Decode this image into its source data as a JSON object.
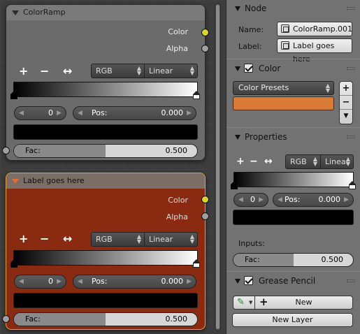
{
  "node1": {
    "title": "ColorRamp",
    "out_color": "Color",
    "out_alpha": "Alpha",
    "mode": "RGB",
    "interp": "Linear",
    "stop_index": "0",
    "pos_label": "Pos:",
    "pos_value": "0.000",
    "fac_label": "Fac:",
    "fac_value": "0.500",
    "fac_fraction": 0.5
  },
  "node2": {
    "title": "Label goes here",
    "out_color": "Color",
    "out_alpha": "Alpha",
    "mode": "RGB",
    "interp": "Linear",
    "stop_index": "0",
    "pos_label": "Pos:",
    "pos_value": "0.000",
    "fac_label": "Fac:",
    "fac_value": "0.500",
    "fac_fraction": 0.5,
    "color": "#8a2a10"
  },
  "controls": {
    "add": "+",
    "remove": "−",
    "flip": "↔"
  },
  "panel": {
    "node_section": {
      "title": "Node",
      "name_label": "Name:",
      "name_value": "ColorRamp.001",
      "label_label": "Label:",
      "label_value": "Label goes here"
    },
    "color_section": {
      "title": "Color",
      "presets": "Color Presets",
      "swatch": "#d97a36",
      "add": "+",
      "remove": "−",
      "menu": "▼"
    },
    "properties_section": {
      "title": "Properties",
      "mode": "RGB",
      "interp": "Linear",
      "stop_index": "0",
      "pos_label": "Pos:",
      "pos_value": "0.000",
      "inputs_label": "Inputs:",
      "fac_label": "Fac:",
      "fac_value": "0.500",
      "fac_fraction": 0.5
    },
    "grease_section": {
      "title": "Grease Pencil",
      "new_label": "New",
      "new_layer_label": "New Layer"
    }
  }
}
